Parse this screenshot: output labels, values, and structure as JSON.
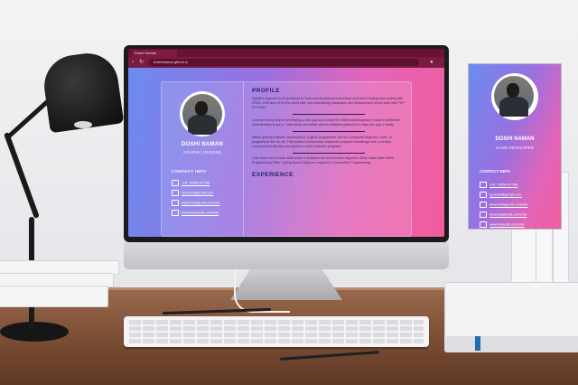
{
  "browser": {
    "tab_title": "Doshi Naman",
    "url": "doshinaman.github.io"
  },
  "resume": {
    "name": "DOSHI NAMAN",
    "role": "GRAPHIC DESIGNE",
    "contact_title": "CONTACT INFO",
    "contacts": [
      {
        "icon": "phone-icon",
        "text": "+91 74654 67766"
      },
      {
        "icon": "mail-icon",
        "text": "npdosh@gmail.com"
      },
      {
        "icon": "instagram-icon",
        "text": "www.instagram.com/me"
      },
      {
        "icon": "facebook-icon",
        "text": "www.facebook.com/me"
      }
    ],
    "profile_title": "PROFILE",
    "profile_p1": "Myself is required to be proficient in Front end development and Back-end Web Development coding with HTML, CSS and JS for the client side, and maintaining Databases and Infrastructure server-side with PHP, PYTHON.",
    "profile_p2": "I oversee every step in developing a new app and involve the initial workshopping of ideas to determine what direction to go in. I take ideas and utilize various software platforms to make this app a reality.",
    "profile_p3": "Within gaming software development, a game programmer can be a computer engineer, coder, or programmer like as me. This position incorporates advanced computer knowledge with a creative component to develop new games or other software programs.",
    "profile_p4": "I just done one of those skills which is acquired by me and that's Algorithm Skills, Basic Math Skills, Programming Skills, Typing Speed Skills are required in Competitive Programming.",
    "experience_title": "EXPERIENCE"
  },
  "portrait_card": {
    "name": "DOSHI NAMAN",
    "role": "GAME DEVELOPER",
    "contact_title": "CONTACT INFO",
    "contacts": [
      {
        "icon": "phone-icon",
        "text": "+91 74654 67766"
      },
      {
        "icon": "mail-icon",
        "text": "npdosh@gmail.com"
      },
      {
        "icon": "instagram-icon",
        "text": "www.instagram.com/me"
      },
      {
        "icon": "facebook-icon",
        "text": "www.facebook.com/me"
      },
      {
        "icon": "linkedin-icon",
        "text": "www.linkedin.com/me"
      }
    ]
  },
  "colors": {
    "gradient_start": "#6a8cf0",
    "gradient_end": "#f25c9c",
    "heading": "#2a1f6a",
    "browser_chrome": "#7a1c42"
  }
}
